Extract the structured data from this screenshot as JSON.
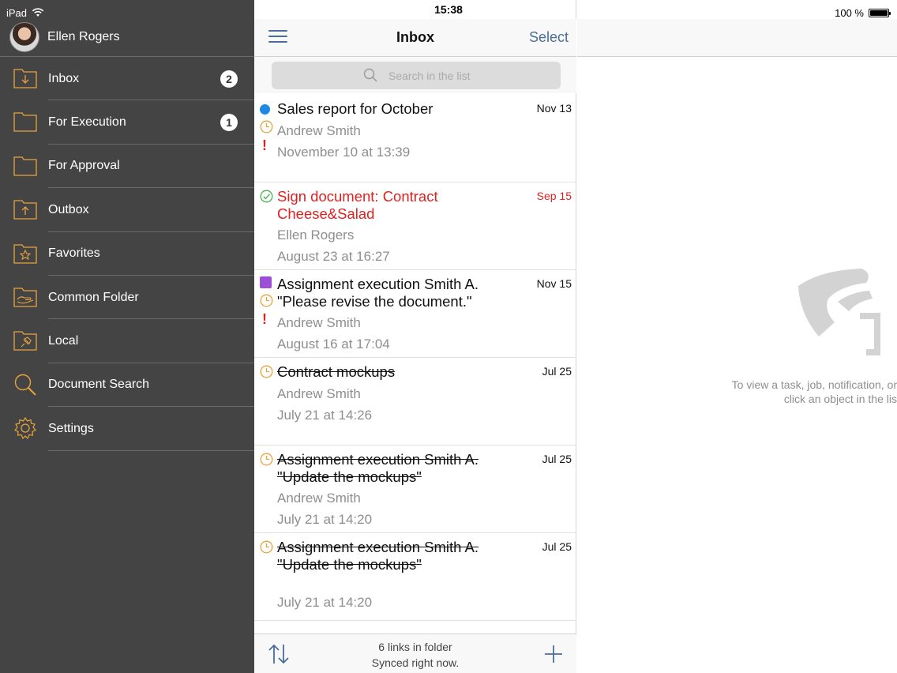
{
  "status_bar": {
    "device": "iPad",
    "time": "15:38",
    "battery": "100 %"
  },
  "sidebar": {
    "user_name": "Ellen Rogers",
    "items": [
      {
        "label": "Inbox",
        "badge": "2",
        "icon": "inbox-folder-icon"
      },
      {
        "label": "For Execution",
        "badge": "1",
        "icon": "folder-icon"
      },
      {
        "label": "For Approval",
        "badge": "",
        "icon": "folder-icon"
      },
      {
        "label": "Outbox",
        "badge": "",
        "icon": "outbox-folder-icon"
      },
      {
        "label": "Favorites",
        "badge": "",
        "icon": "star-folder-icon"
      },
      {
        "label": "Common Folder",
        "badge": "",
        "icon": "shared-folder-icon"
      },
      {
        "label": "Local",
        "badge": "",
        "icon": "pin-folder-icon"
      },
      {
        "label": "Document Search",
        "badge": "",
        "icon": "search-icon"
      },
      {
        "label": "Settings",
        "badge": "",
        "icon": "gear-icon"
      }
    ]
  },
  "list": {
    "title": "Inbox",
    "select_label": "Select",
    "search_placeholder": "Search in the list",
    "items": [
      {
        "title": "Sales report for October",
        "author": "Andrew Smith",
        "time": "November 10 at 13:39",
        "date": "Nov 13",
        "state": "new-important"
      },
      {
        "title": "Sign document: Contract Cheese&Salad",
        "author": "Ellen Rogers",
        "time": "August 23 at 16:27",
        "date": "Sep 15",
        "state": "overdue-done"
      },
      {
        "title": "Assignment execution Smith A. \"Please revise the document.\"",
        "author": "Andrew Smith",
        "time": "August 16 at 17:04",
        "date": "Nov 15",
        "state": "assignment-important"
      },
      {
        "title": "Contract mockups",
        "author": "Andrew Smith",
        "time": "July 21 at 14:26",
        "date": "Jul 25",
        "state": "completed"
      },
      {
        "title": "Assignment execution Smith A. \"Update the mockups\"",
        "author": "Andrew Smith",
        "time": "July 21 at 14:20",
        "date": "Jul 25",
        "state": "completed"
      },
      {
        "title": "Assignment execution Smith A. \"Update the mockups\"",
        "author": "",
        "time": "July 21 at 14:20",
        "date": "Jul 25",
        "state": "completed"
      }
    ],
    "footer_line1": "6 links in folder",
    "footer_line2": "Synced right now."
  },
  "detail": {
    "hint_line1": "To view a task, job, notification, or",
    "hint_line2": "click an object in the lis"
  },
  "colors": {
    "accent": "#4a6e9a",
    "sidebar_bg": "#444444",
    "icon_orange": "#e8a33d",
    "alert_red": "#e32020"
  }
}
